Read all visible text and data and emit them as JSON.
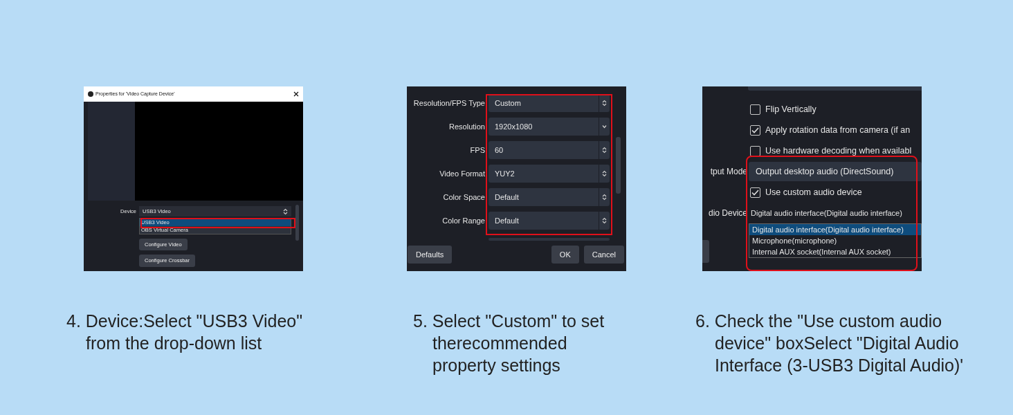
{
  "steps": [
    {
      "kind": "device",
      "caption": [
        "4. Device:Select \"USB3 Video\"",
        "from the drop-down list"
      ],
      "screen": {
        "title": "Properties for 'Video Capture Device'",
        "device_label": "Device",
        "device_value": "USB3 Video",
        "options": [
          {
            "label": "USB3 Video",
            "selected": true
          },
          {
            "label": "OBS Virtual Camera",
            "selected": false
          }
        ],
        "buttons": [
          "Configure Video",
          "Configure Crossbar"
        ]
      }
    },
    {
      "kind": "resolution",
      "caption": [
        "5. Select \"Custom\" to set",
        "therecommended",
        "property settings"
      ],
      "screen": {
        "rows": [
          {
            "label": "Resolution/FPS Type",
            "value": "Custom",
            "kind": "spinner"
          },
          {
            "label": "Resolution",
            "value": "1920x1080",
            "kind": "dropdown"
          },
          {
            "label": "FPS",
            "value": "60",
            "kind": "spinner"
          },
          {
            "label": "Video Format",
            "value": "YUY2",
            "kind": "spinner"
          },
          {
            "label": "Color Space",
            "value": "Default",
            "kind": "spinner"
          },
          {
            "label": "Color Range",
            "value": "Default",
            "kind": "spinner"
          }
        ],
        "left_button": "Defaults",
        "buttons": [
          "OK",
          "Cancel"
        ]
      }
    },
    {
      "kind": "audio",
      "caption": [
        "6. Check the \"Use custom audio",
        "device\" boxSelect \"Digital Audio",
        "Interface (3-USB3 Digital Audio)'"
      ],
      "screen": {
        "rows": [
          {
            "kind": "checkbox",
            "label": "Flip Vertically",
            "checked": false
          },
          {
            "kind": "checkbox",
            "label": "Apply rotation data from camera (if an",
            "checked": true
          },
          {
            "kind": "checkbox",
            "label": "Use hardware decoding when availabl",
            "checked": false
          },
          {
            "kind": "select",
            "label": "tput Mode",
            "value": "Output desktop audio (DirectSound)"
          },
          {
            "kind": "checkbox",
            "label": "Use custom audio device",
            "checked": true
          },
          {
            "kind": "select",
            "label": "dio Device",
            "value": "Digital audio interface(Digital audio interface)"
          }
        ],
        "options": [
          {
            "label": "Digital audio interface(Digital audio interface)",
            "selected": true
          },
          {
            "label": "Microphone(microphone)",
            "selected": false
          },
          {
            "label": "Internal AUX socket(Internal AUX socket)",
            "selected": false
          }
        ]
      }
    }
  ]
}
